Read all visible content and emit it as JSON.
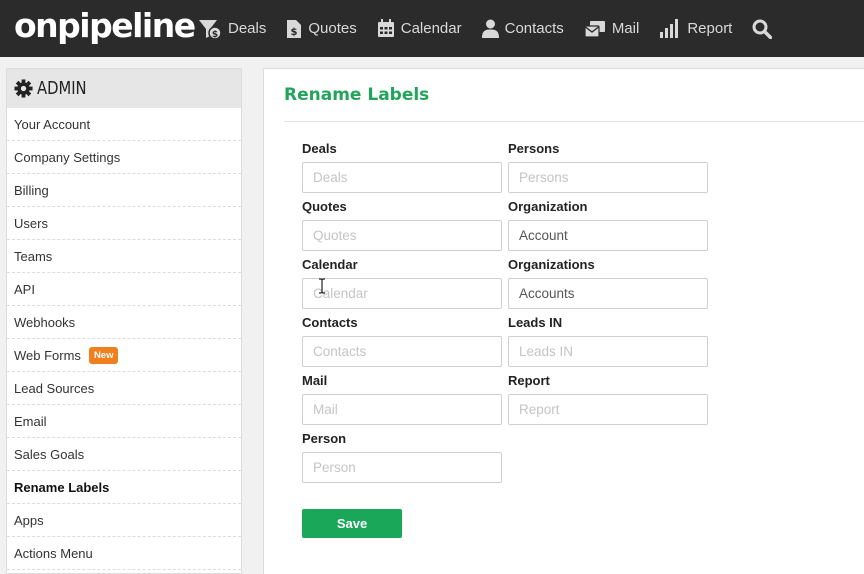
{
  "header": {
    "logo": "onpipeline",
    "nav": [
      {
        "label": "Deals",
        "icon": "deals-funnel-icon"
      },
      {
        "label": "Quotes",
        "icon": "quotes-document-icon"
      },
      {
        "label": "Calendar",
        "icon": "calendar-icon"
      },
      {
        "label": "Contacts",
        "icon": "contacts-person-icon"
      },
      {
        "label": "Mail",
        "icon": "mail-icon"
      },
      {
        "label": "Report",
        "icon": "report-bars-icon"
      }
    ],
    "search_icon": "search-icon"
  },
  "sidebar": {
    "title": "ADMIN",
    "title_icon": "gear-icon",
    "items": [
      {
        "label": "Your Account"
      },
      {
        "label": "Company Settings"
      },
      {
        "label": "Billing"
      },
      {
        "label": "Users"
      },
      {
        "label": "Teams"
      },
      {
        "label": "API"
      },
      {
        "label": "Webhooks"
      },
      {
        "label": "Web Forms",
        "badge": "New"
      },
      {
        "label": "Lead Sources"
      },
      {
        "label": "Email"
      },
      {
        "label": "Sales Goals"
      },
      {
        "label": "Rename Labels",
        "active": true
      },
      {
        "label": "Apps"
      },
      {
        "label": "Actions Menu"
      }
    ]
  },
  "main": {
    "title": "Rename Labels",
    "fields": [
      {
        "label": "Deals",
        "placeholder": "Deals",
        "value": ""
      },
      {
        "label": "Persons",
        "placeholder": "Persons",
        "value": ""
      },
      {
        "label": "Quotes",
        "placeholder": "Quotes",
        "value": ""
      },
      {
        "label": "Organization",
        "placeholder": "Organization",
        "value": "Account"
      },
      {
        "label": "Calendar",
        "placeholder": "Calendar",
        "value": ""
      },
      {
        "label": "Organizations",
        "placeholder": "Organizations",
        "value": "Accounts"
      },
      {
        "label": "Contacts",
        "placeholder": "Contacts",
        "value": ""
      },
      {
        "label": "Leads IN",
        "placeholder": "Leads IN",
        "value": ""
      },
      {
        "label": "Mail",
        "placeholder": "Mail",
        "value": ""
      },
      {
        "label": "Report",
        "placeholder": "Report",
        "value": ""
      },
      {
        "label": "Person",
        "placeholder": "Person",
        "value": ""
      }
    ],
    "save_label": "Save"
  },
  "colors": {
    "topbar": "#2b2b2b",
    "accent_green": "#1aa759",
    "badge_orange": "#f07f1d"
  }
}
